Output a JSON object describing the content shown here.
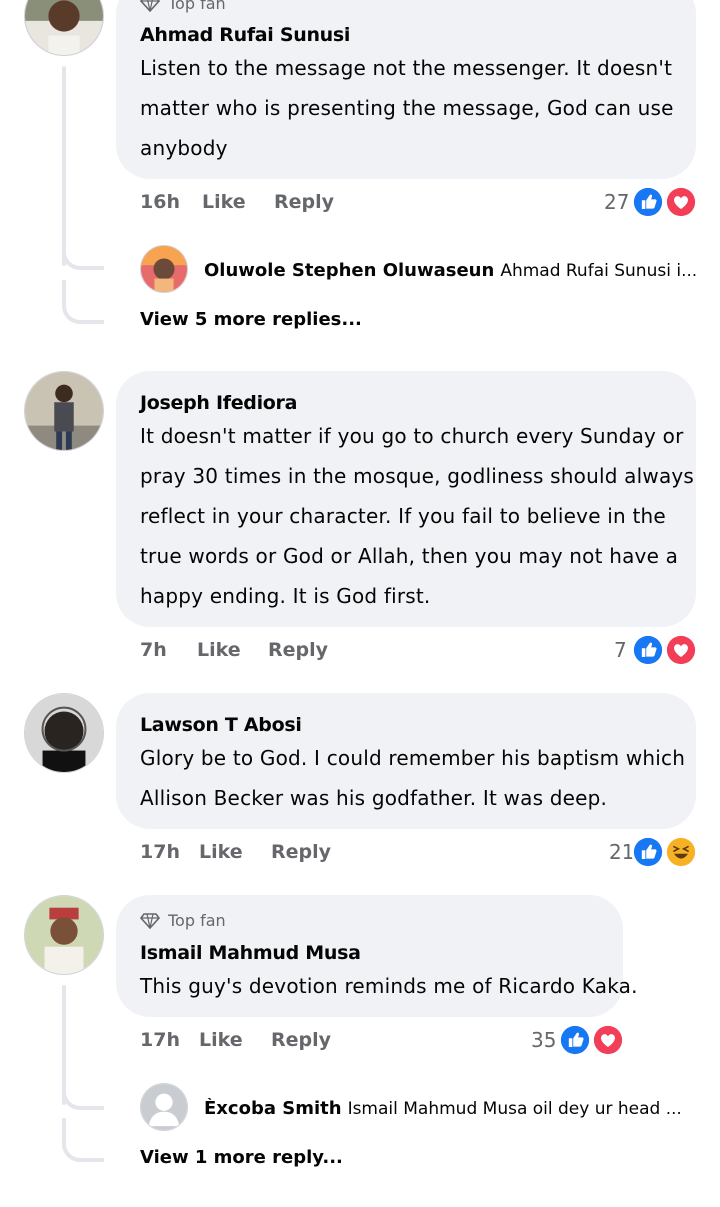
{
  "comments": [
    {
      "badge": "Top fan",
      "name": "Ahmad Rufai Sunusi",
      "text_lines": [
        "Listen to the message not the messenger. It doesn't",
        "matter who is presenting the message, God can use",
        "anybody"
      ],
      "time": "16h",
      "like": "Like",
      "reply": "Reply",
      "reactions": "27",
      "reaction_icons": [
        "like-icon",
        "love-icon"
      ],
      "reply_preview": {
        "name": "Oluwole Stephen Oluwaseun",
        "text": "Ahmad Rufai Sunusi i respect y..."
      },
      "view_more": "View 5 more replies..."
    },
    {
      "name": "Joseph Ifediora",
      "text_lines": [
        "It doesn't matter if you go to church every Sunday or",
        "pray 30 times in the mosque, godliness should always",
        "reflect in your character. If you fail to believe in the",
        "true words or God or Allah, then you may not have a",
        "happy ending. It is God first."
      ],
      "time": "7h",
      "like": "Like",
      "reply": "Reply",
      "reactions": "7",
      "reaction_icons": [
        "like-icon",
        "love-icon"
      ]
    },
    {
      "name": "Lawson T Abosi",
      "text_lines": [
        "Glory be to God. I could remember his baptism which",
        "Allison Becker was his godfather. It was deep."
      ],
      "time": "17h",
      "like": "Like",
      "reply": "Reply",
      "reactions": "21",
      "reaction_icons": [
        "like-icon",
        "haha-icon"
      ]
    },
    {
      "badge": "Top fan",
      "name": "Ismail Mahmud Musa",
      "text_lines": [
        "This guy's devotion reminds me of Ricardo Kaka."
      ],
      "time": "17h",
      "like": "Like",
      "reply": "Reply",
      "reactions": "35",
      "reaction_icons": [
        "like-icon",
        "love-icon"
      ],
      "reply_preview": {
        "name": "Èxcoba Smith",
        "text": "Ismail Mahmud Musa oil dey ur head 🙌❤️"
      },
      "view_more": "View 1 more reply..."
    }
  ],
  "colors": {
    "like_blue": "#1877f2",
    "love_red": "#f33e58",
    "haha_yellow": "#f7b125",
    "bubble_bg": "#f0f2f5",
    "meta_gray": "#65676b"
  }
}
